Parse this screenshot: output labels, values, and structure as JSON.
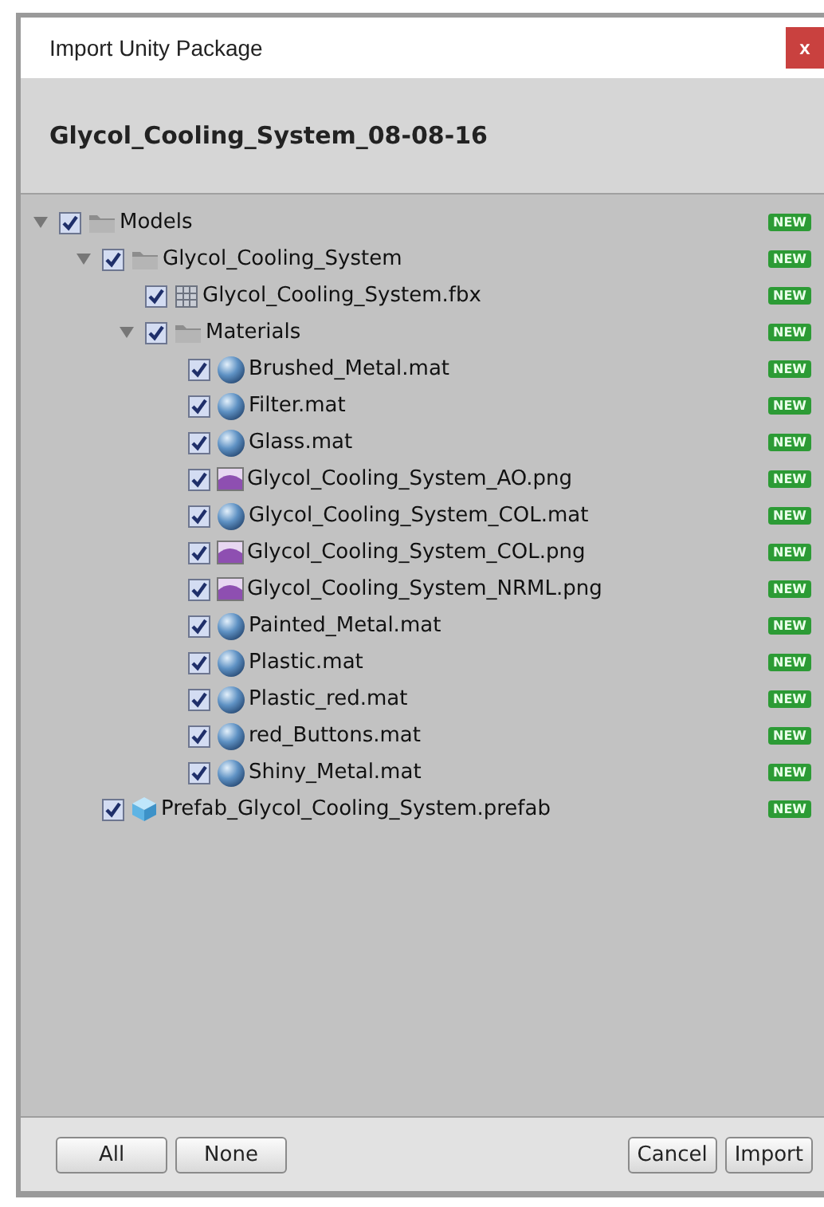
{
  "window": {
    "title": "Import Unity Package",
    "close": "x"
  },
  "package_name": "Glycol_Cooling_System_08-08-16",
  "tree": [
    {
      "name": "Models",
      "kind": "folder",
      "checked": true,
      "expanded": true,
      "badge": "NEW",
      "children": [
        {
          "name": "Glycol_Cooling_System",
          "kind": "folder",
          "checked": true,
          "expanded": true,
          "badge": "NEW",
          "children": [
            {
              "name": "Glycol_Cooling_System.fbx",
              "kind": "mesh",
              "checked": true,
              "badge": "NEW"
            },
            {
              "name": "Materials",
              "kind": "folder",
              "checked": true,
              "expanded": true,
              "badge": "NEW",
              "children": [
                {
                  "name": "Brushed_Metal.mat",
                  "kind": "material",
                  "checked": true,
                  "badge": "NEW"
                },
                {
                  "name": "Filter.mat",
                  "kind": "material",
                  "checked": true,
                  "badge": "NEW"
                },
                {
                  "name": "Glass.mat",
                  "kind": "material",
                  "checked": true,
                  "badge": "NEW"
                },
                {
                  "name": "Glycol_Cooling_System_AO.png",
                  "kind": "texture",
                  "checked": true,
                  "badge": "NEW"
                },
                {
                  "name": "Glycol_Cooling_System_COL.mat",
                  "kind": "material",
                  "checked": true,
                  "badge": "NEW"
                },
                {
                  "name": "Glycol_Cooling_System_COL.png",
                  "kind": "texture",
                  "checked": true,
                  "badge": "NEW"
                },
                {
                  "name": "Glycol_Cooling_System_NRML.png",
                  "kind": "texture",
                  "checked": true,
                  "badge": "NEW"
                },
                {
                  "name": "Painted_Metal.mat",
                  "kind": "material",
                  "checked": true,
                  "badge": "NEW"
                },
                {
                  "name": "Plastic.mat",
                  "kind": "material",
                  "checked": true,
                  "badge": "NEW"
                },
                {
                  "name": "Plastic_red.mat",
                  "kind": "material",
                  "checked": true,
                  "badge": "NEW"
                },
                {
                  "name": "red_Buttons.mat",
                  "kind": "material",
                  "checked": true,
                  "badge": "NEW"
                },
                {
                  "name": "Shiny_Metal.mat",
                  "kind": "material",
                  "checked": true,
                  "badge": "NEW"
                }
              ]
            }
          ]
        },
        {
          "name": "Prefab_Glycol_Cooling_System.prefab",
          "kind": "prefab",
          "checked": true,
          "badge": "NEW"
        }
      ]
    }
  ],
  "buttons_left": [
    "All",
    "None"
  ],
  "buttons_right": [
    "Cancel",
    "Import"
  ]
}
